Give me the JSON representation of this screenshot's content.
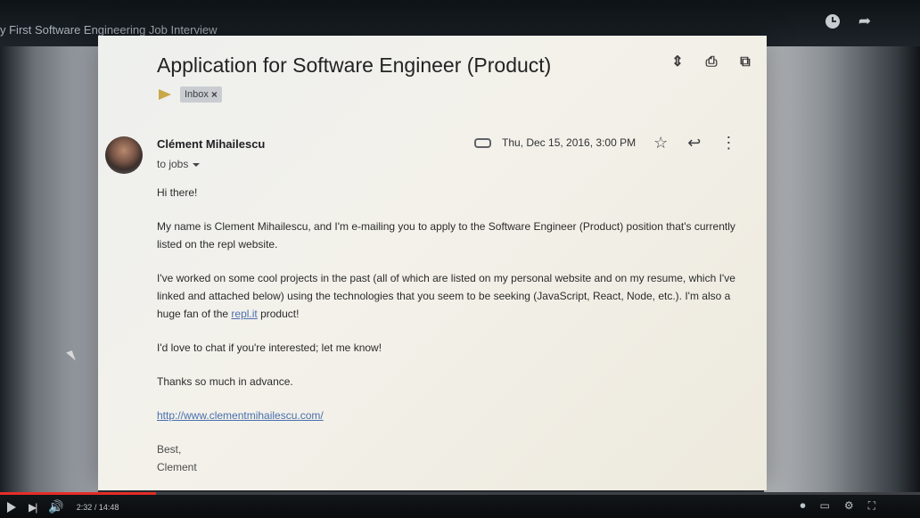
{
  "video": {
    "title": "y First Software Engineering Job Interview",
    "time": "2:32 / 14:48",
    "progress_fraction": 0.17
  },
  "email": {
    "subject": "Application for Software Engineer (Product)",
    "label": "Inbox",
    "sender_name": "Clément Mihailescu",
    "recipient": "to jobs",
    "date": "Thu, Dec 15, 2016, 3:00 PM",
    "body": {
      "greeting": "Hi there!",
      "p1": "My name is Clement Mihailescu, and I'm e-mailing you to apply to the Software Engineer (Product) position that's currently listed on the repl website.",
      "p2_before": "I've worked on some cool projects in the past (all of which are listed on my personal website and on my resume, which I've linked and attached below) using the technologies that you seem to be seeking (JavaScript, React, Node, etc.). I'm also a huge fan of the ",
      "p2_link": "repl.it",
      "p2_after": " product!",
      "p3": "I'd love to chat if you're interested; let me know!",
      "p4": "Thanks so much in advance.",
      "website": "http://www.clementmihailescu.com/",
      "closing": "Best,",
      "signature": "Clement"
    }
  },
  "icons": {
    "subject_actions": [
      "expand-icon",
      "print-icon",
      "open-in-new-icon"
    ],
    "meta_actions": [
      "star-icon",
      "reply-icon",
      "more-vert-icon"
    ],
    "top_actions": [
      "clock-icon",
      "share-icon"
    ]
  }
}
